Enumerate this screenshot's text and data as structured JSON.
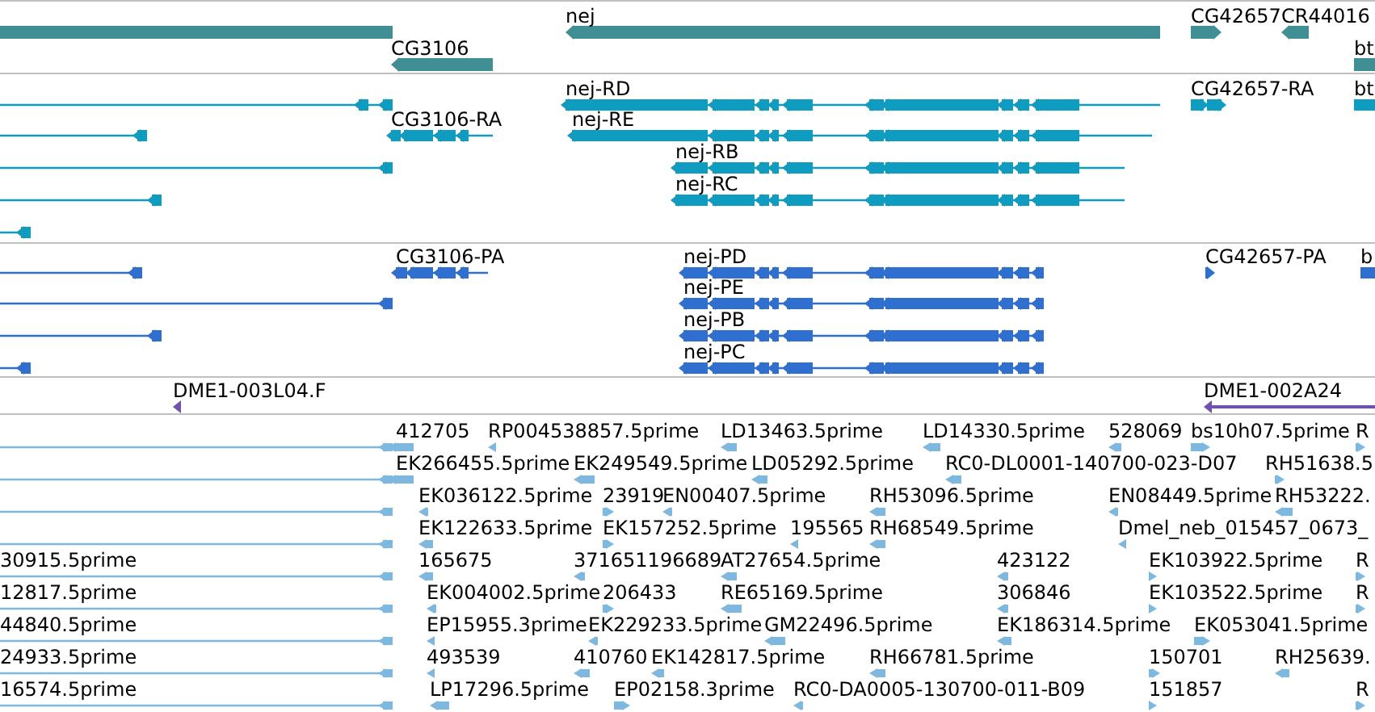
{
  "tracks": [
    {
      "kind": "genes",
      "color": "#3f8f95",
      "lanes": [
        {
          "features": [
            {
              "kind": "plain"
            },
            {
              "label": "nej",
              "kind": "minus"
            },
            {
              "label": "CG42657",
              "kind": "plus"
            },
            {
              "label": "CR44016",
              "kind": "minus"
            }
          ]
        },
        {
          "features": [
            {
              "label": "CG3106",
              "kind": "minus"
            },
            {
              "label": "bt",
              "kind": "plain"
            }
          ]
        }
      ]
    },
    {
      "kind": "transcripts",
      "color": "#0e9cc0",
      "lanes": [
        {
          "features": [
            {
              "kind": "minus"
            },
            {
              "label": "nej-RD",
              "kind": "minus"
            },
            {
              "label": "CG42657-RA",
              "kind": "plus"
            },
            {
              "label": "bt",
              "kind": "plain"
            }
          ]
        },
        {
          "features": [
            {
              "kind": "minus"
            },
            {
              "label": "CG3106-RA",
              "kind": "minus"
            },
            {
              "label": "nej-RE",
              "kind": "minus"
            }
          ]
        },
        {
          "features": [
            {
              "kind": "minus"
            },
            {
              "label": "nej-RB",
              "kind": "minus"
            }
          ]
        },
        {
          "features": [
            {
              "kind": "minus"
            },
            {
              "label": "nej-RC",
              "kind": "minus"
            }
          ]
        },
        {
          "features": [
            {
              "kind": "minus"
            }
          ]
        }
      ]
    },
    {
      "kind": "proteins",
      "color": "#2f6fd0",
      "lanes": [
        {
          "features": [
            {
              "kind": "minus"
            },
            {
              "label": "CG3106-PA",
              "kind": "minus"
            },
            {
              "label": "nej-PD",
              "kind": "minus"
            },
            {
              "label": "CG42657-PA",
              "kind": "plus"
            },
            {
              "label": "b",
              "kind": "plain"
            }
          ]
        },
        {
          "features": [
            {
              "kind": "minus"
            },
            {
              "label": "nej-PE",
              "kind": "minus"
            }
          ]
        },
        {
          "features": [
            {
              "kind": "minus"
            },
            {
              "label": "nej-PB",
              "kind": "minus"
            }
          ]
        },
        {
          "features": [
            {
              "kind": "minus"
            },
            {
              "label": "nej-PC",
              "kind": "minus"
            }
          ]
        }
      ]
    },
    {
      "kind": "clones",
      "color": "#7050b0",
      "lanes": [
        {
          "features": [
            {
              "label": "DME1-003L04.F",
              "kind": "minus"
            },
            {
              "label": "DME1-002A24",
              "kind": "minus"
            }
          ]
        }
      ]
    },
    {
      "kind": "ests",
      "color": "#7cb8e0",
      "lanes": [
        {
          "features": [
            {
              "kind": "minus"
            },
            {
              "label": "412705",
              "kind": "minus"
            },
            {
              "label": "RP004538857.5prime",
              "kind": "minus"
            },
            {
              "label": "LD13463.5prime",
              "kind": "minus"
            },
            {
              "label": "LD14330.5prime",
              "kind": "minus"
            },
            {
              "label": "528069",
              "kind": "minus"
            },
            {
              "label": "bs10h07.5prime",
              "kind": "plus"
            },
            {
              "label": "R",
              "kind": "plus"
            }
          ]
        },
        {
          "features": [
            {
              "kind": "minus"
            },
            {
              "label": "EK266455.5prime",
              "kind": "minus"
            },
            {
              "label": "EK249549.5prime",
              "kind": "minus"
            },
            {
              "label": "LD05292.5prime",
              "kind": "minus"
            },
            {
              "label": "RC0-DL0001-140700-023-D07",
              "kind": "minus"
            },
            {
              "label": "RH51638.5",
              "kind": "plus"
            }
          ]
        },
        {
          "features": [
            {
              "kind": "minus"
            },
            {
              "label": "EK036122.5prime",
              "kind": "minus"
            },
            {
              "label": "23919",
              "kind": "plus"
            },
            {
              "label": "EN00407.5prime",
              "kind": "minus"
            },
            {
              "label": "RH53096.5prime",
              "kind": "minus"
            },
            {
              "label": "EN08449.5prime",
              "kind": "minus"
            },
            {
              "label": "RH53222.",
              "kind": "minus"
            }
          ]
        },
        {
          "features": [
            {
              "kind": "minus"
            },
            {
              "label": "EK122633.5prime",
              "kind": "minus"
            },
            {
              "label": "EK157252.5prime",
              "kind": "plus"
            },
            {
              "label": "195565",
              "kind": "minus"
            },
            {
              "label": "RH68549.5prime",
              "kind": "minus"
            },
            {
              "label": "Dmel_neb_015457_0673_",
              "kind": "minus"
            }
          ]
        },
        {
          "features": [
            {
              "label": "30915.5prime",
              "kind": "minus"
            },
            {
              "label": "165675",
              "kind": "minus"
            },
            {
              "label": "371651196689",
              "kind": "minus"
            },
            {
              "label": "AT27654.5prime",
              "kind": "minus"
            },
            {
              "label": "423122",
              "kind": "minus"
            },
            {
              "label": "EK103922.5prime",
              "kind": "plus"
            },
            {
              "label": "R",
              "kind": "plus"
            }
          ]
        },
        {
          "features": [
            {
              "label": "12817.5prime",
              "kind": "minus"
            },
            {
              "label": "EK004002.5prime",
              "kind": "minus"
            },
            {
              "label": "206433",
              "kind": "plus"
            },
            {
              "label": "RE65169.5prime",
              "kind": "minus"
            },
            {
              "label": "306846",
              "kind": "minus"
            },
            {
              "label": "EK103522.5prime",
              "kind": "plus"
            },
            {
              "label": "R",
              "kind": "plus"
            }
          ]
        },
        {
          "features": [
            {
              "label": "44840.5prime",
              "kind": "minus"
            },
            {
              "label": "EP15955.3prime",
              "kind": "minus"
            },
            {
              "label": "EK229233.5prime",
              "kind": "minus"
            },
            {
              "label": "GM22496.5prime",
              "kind": "minus"
            },
            {
              "label": "EK186314.5prime",
              "kind": "minus"
            },
            {
              "label": "EK053041.5prime",
              "kind": "plus"
            }
          ]
        },
        {
          "features": [
            {
              "label": "24933.5prime",
              "kind": "minus"
            },
            {
              "label": "493539",
              "kind": "minus"
            },
            {
              "label": "410760",
              "kind": "minus"
            },
            {
              "label": "EK142817.5prime",
              "kind": "minus"
            },
            {
              "label": "RH66781.5prime",
              "kind": "minus"
            },
            {
              "label": "150701",
              "kind": "plus"
            },
            {
              "label": "RH25639.",
              "kind": "minus"
            }
          ]
        },
        {
          "features": [
            {
              "label": "16574.5prime",
              "kind": "minus"
            },
            {
              "label": "LP17296.5prime",
              "kind": "minus"
            },
            {
              "label": "EP02158.3prime",
              "kind": "plus"
            },
            {
              "label": "RC0-DA0005-130700-011-B09",
              "kind": "minus"
            },
            {
              "label": "151857",
              "kind": "plus"
            },
            {
              "label": "R",
              "kind": "plus"
            }
          ]
        }
      ]
    }
  ]
}
